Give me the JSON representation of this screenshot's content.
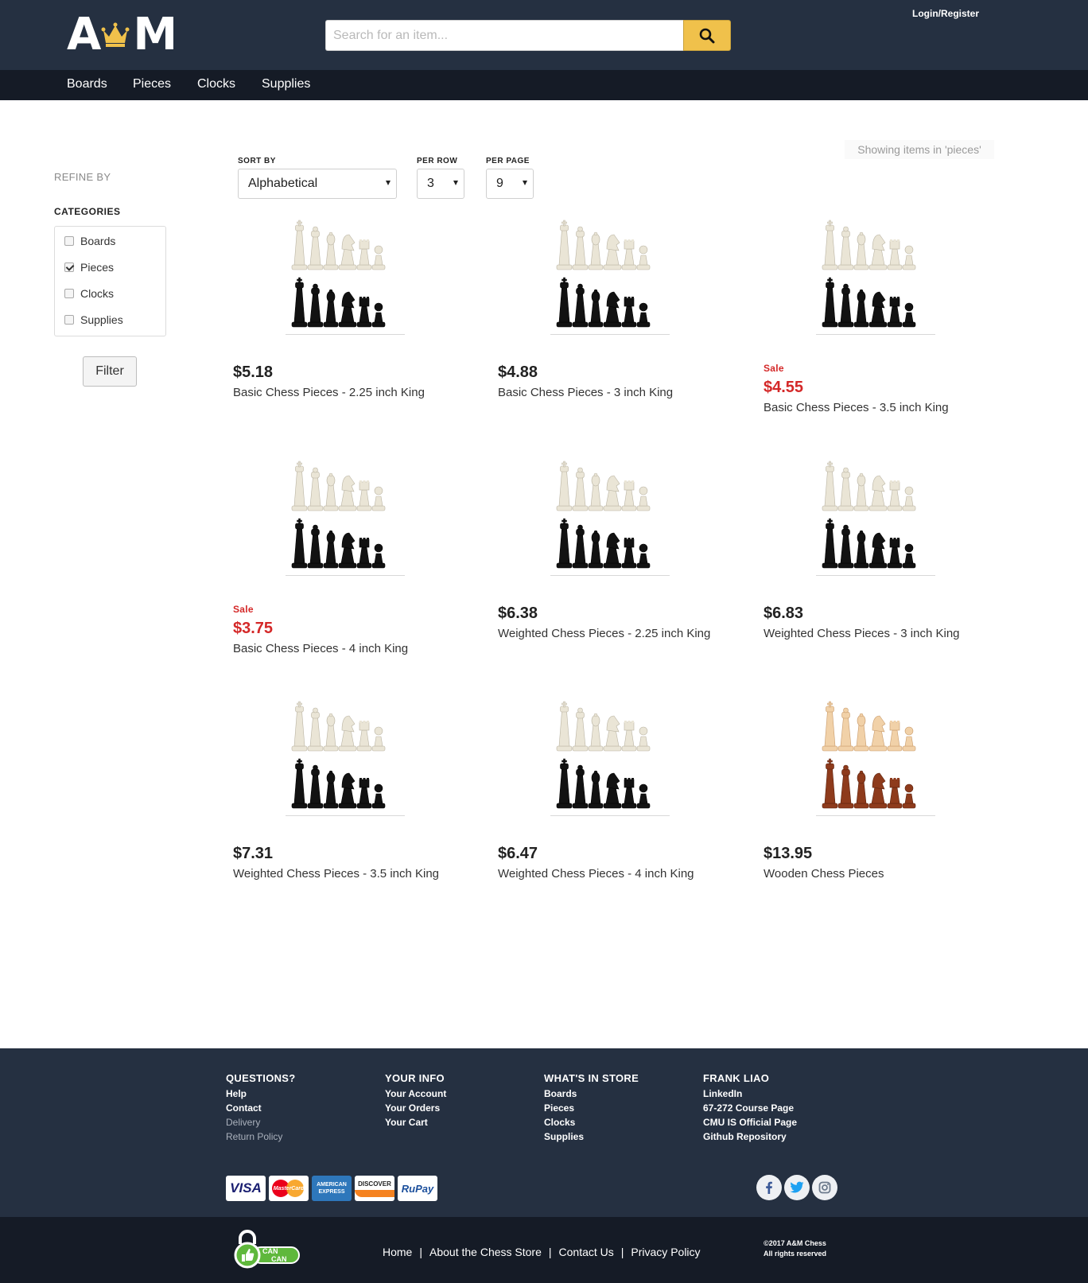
{
  "header": {
    "logo_left": "A",
    "logo_right": "M",
    "search_placeholder": "Search for an item...",
    "login_label": "Login/Register",
    "accent": "#f0c14b",
    "bg": "#253041"
  },
  "nav": [
    "Boards",
    "Pieces",
    "Clocks",
    "Supplies"
  ],
  "sidebar": {
    "refine_label": "REFINE BY",
    "categories_label": "CATEGORIES",
    "categories": [
      {
        "label": "Boards",
        "checked": false
      },
      {
        "label": "Pieces",
        "checked": true
      },
      {
        "label": "Clocks",
        "checked": false
      },
      {
        "label": "Supplies",
        "checked": false
      }
    ],
    "filter_label": "Filter"
  },
  "controls": {
    "sort_label": "SORT BY",
    "sort_value": "Alphabetical",
    "per_row_label": "PER ROW",
    "per_row_value": "3",
    "per_page_label": "PER PAGE",
    "per_page_value": "9",
    "showing_text": "Showing items in 'pieces'"
  },
  "products": [
    {
      "price": "$5.18",
      "name": "Basic Chess Pieces - 2.25 inch King",
      "sale": "",
      "style": "plastic"
    },
    {
      "price": "$4.88",
      "name": "Basic Chess Pieces - 3 inch King",
      "sale": "",
      "style": "plastic"
    },
    {
      "price": "$4.55",
      "name": "Basic Chess Pieces - 3.5 inch King",
      "sale": "Sale",
      "style": "plastic"
    },
    {
      "price": "$3.75",
      "name": "Basic Chess Pieces - 4 inch King",
      "sale": "Sale",
      "style": "plastic"
    },
    {
      "price": "$6.38",
      "name": "Weighted Chess Pieces - 2.25 inch King",
      "sale": "",
      "style": "plastic"
    },
    {
      "price": "$6.83",
      "name": "Weighted Chess Pieces - 3 inch King",
      "sale": "",
      "style": "plastic"
    },
    {
      "price": "$7.31",
      "name": "Weighted Chess Pieces - 3.5 inch King",
      "sale": "",
      "style": "plastic"
    },
    {
      "price": "$6.47",
      "name": "Weighted Chess Pieces - 4 inch King",
      "sale": "",
      "style": "plastic"
    },
    {
      "price": "$13.95",
      "name": "Wooden Chess Pieces",
      "sale": "",
      "style": "wood"
    }
  ],
  "footer": {
    "columns": [
      {
        "title": "QUESTIONS?",
        "links": [
          {
            "label": "Help",
            "dim": false
          },
          {
            "label": "Contact",
            "dim": false
          },
          {
            "label": "Delivery",
            "dim": true
          },
          {
            "label": "Return Policy",
            "dim": true
          }
        ]
      },
      {
        "title": "YOUR INFO",
        "links": [
          {
            "label": "Your Account",
            "dim": false
          },
          {
            "label": "Your Orders",
            "dim": false
          },
          {
            "label": "Your Cart",
            "dim": false
          }
        ]
      },
      {
        "title": "WHAT'S IN STORE",
        "links": [
          {
            "label": "Boards",
            "dim": false
          },
          {
            "label": "Pieces",
            "dim": false
          },
          {
            "label": "Clocks",
            "dim": false
          },
          {
            "label": "Supplies",
            "dim": false
          }
        ]
      },
      {
        "title": "FRANK LIAO",
        "links": [
          {
            "label": "LinkedIn",
            "dim": false
          },
          {
            "label": "67-272 Course Page",
            "dim": false
          },
          {
            "label": "CMU IS Official Page",
            "dim": false
          },
          {
            "label": "Github Repository",
            "dim": false
          }
        ]
      }
    ],
    "payment_cards": [
      "VISA",
      "MasterCard",
      "AMERICAN EXPRESS",
      "DISCOVER",
      "RuPay"
    ],
    "social": [
      "facebook-icon",
      "twitter-icon",
      "instagram-icon"
    ],
    "badge_text_top": "CAN",
    "badge_text_bottom": "CAN",
    "bottom_links": [
      "Home",
      "About the Chess Store",
      "Contact Us",
      "Privacy Policy"
    ],
    "copyright_line1": "©2017 A&M Chess",
    "copyright_line2": "All rights reserved"
  }
}
